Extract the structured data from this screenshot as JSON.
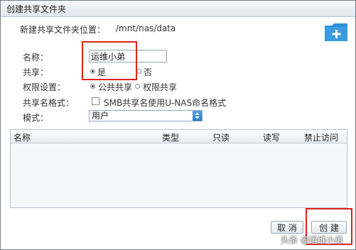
{
  "window": {
    "title": "创建共享文件夹"
  },
  "location": {
    "label": "新建共享文件夹位置：",
    "path": "/mnt/nas/data"
  },
  "icons": {
    "new_folder": "folder-plus-icon"
  },
  "form": {
    "name_label": "名称：",
    "name_value": "运维小弟",
    "share_label": "共享：",
    "share_options": [
      {
        "label": "是",
        "selected": true
      },
      {
        "label": "否",
        "selected": false
      }
    ],
    "permission_label": "权限设置：",
    "permission_options": [
      {
        "label": "公共共享",
        "selected": true
      },
      {
        "label": "权限共享",
        "selected": false
      }
    ],
    "share_name_format_label": "共享名格式：",
    "share_name_format_checkbox": "SMB共享名使用U-NAS命名格式",
    "share_name_format_checked": false,
    "mode_label": "模式：",
    "mode_value": "用户"
  },
  "table": {
    "columns": [
      "名称",
      "类型",
      "只读",
      "读写",
      "禁止访问"
    ]
  },
  "buttons": {
    "cancel": "取 消",
    "create": "创 建"
  },
  "watermark": "头条 @运维小弟",
  "colors": {
    "highlight": "#e0221b",
    "folder_icon": "#3a9be0"
  }
}
